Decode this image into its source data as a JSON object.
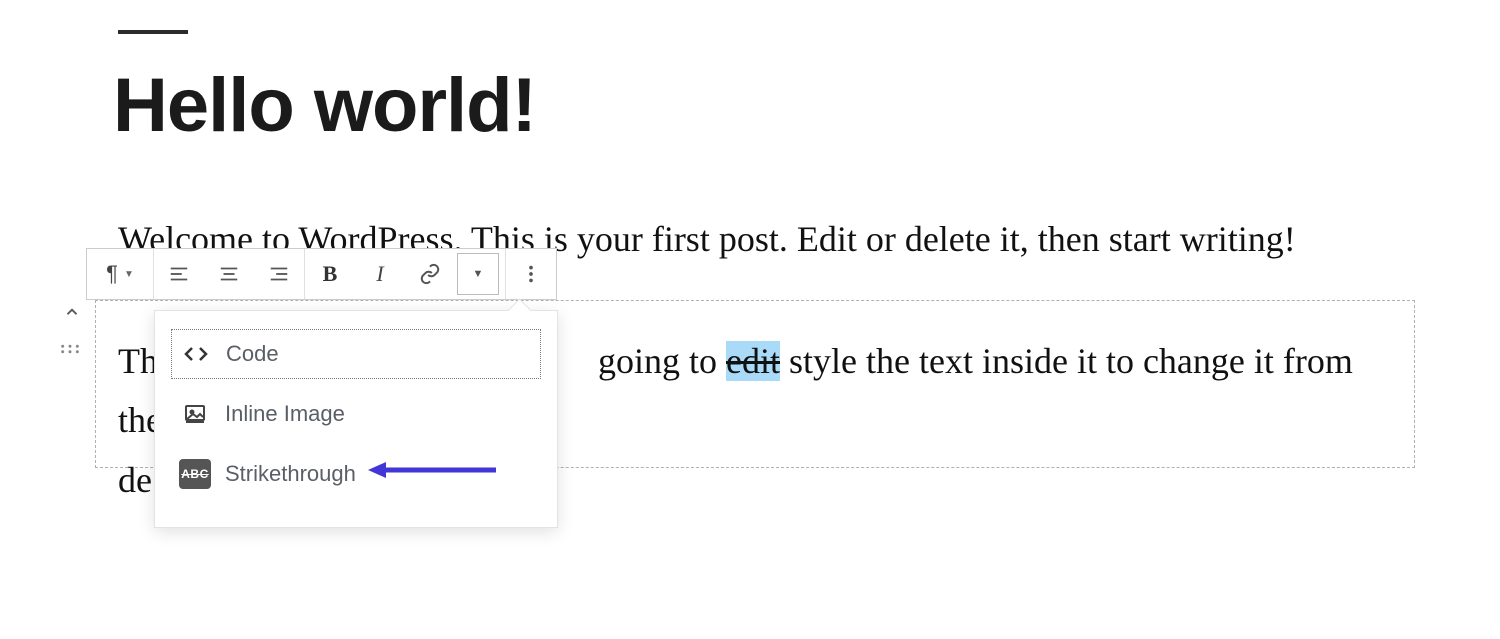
{
  "post": {
    "title": "Hello world!",
    "paragraph1": "Welcome to WordPress. This is your first post. Edit or delete it, then start writing!",
    "paragraph2": {
      "pre_hidden": "Th",
      "mid1": "going to ",
      "highlighted": "edit",
      "mid2": " style the text inside it to change it from the",
      "line2": "de"
    }
  },
  "toolbar": {
    "paragraph_symbol": "¶",
    "bold": "B",
    "italic": "I",
    "dropdown_caret": "▼"
  },
  "dropdown": {
    "code": "Code",
    "inline_image": "Inline Image",
    "strikethrough": "Strikethrough",
    "abc_badge": "ABC"
  },
  "gutter": {
    "drag_dots": "⋮⋮⋮"
  }
}
